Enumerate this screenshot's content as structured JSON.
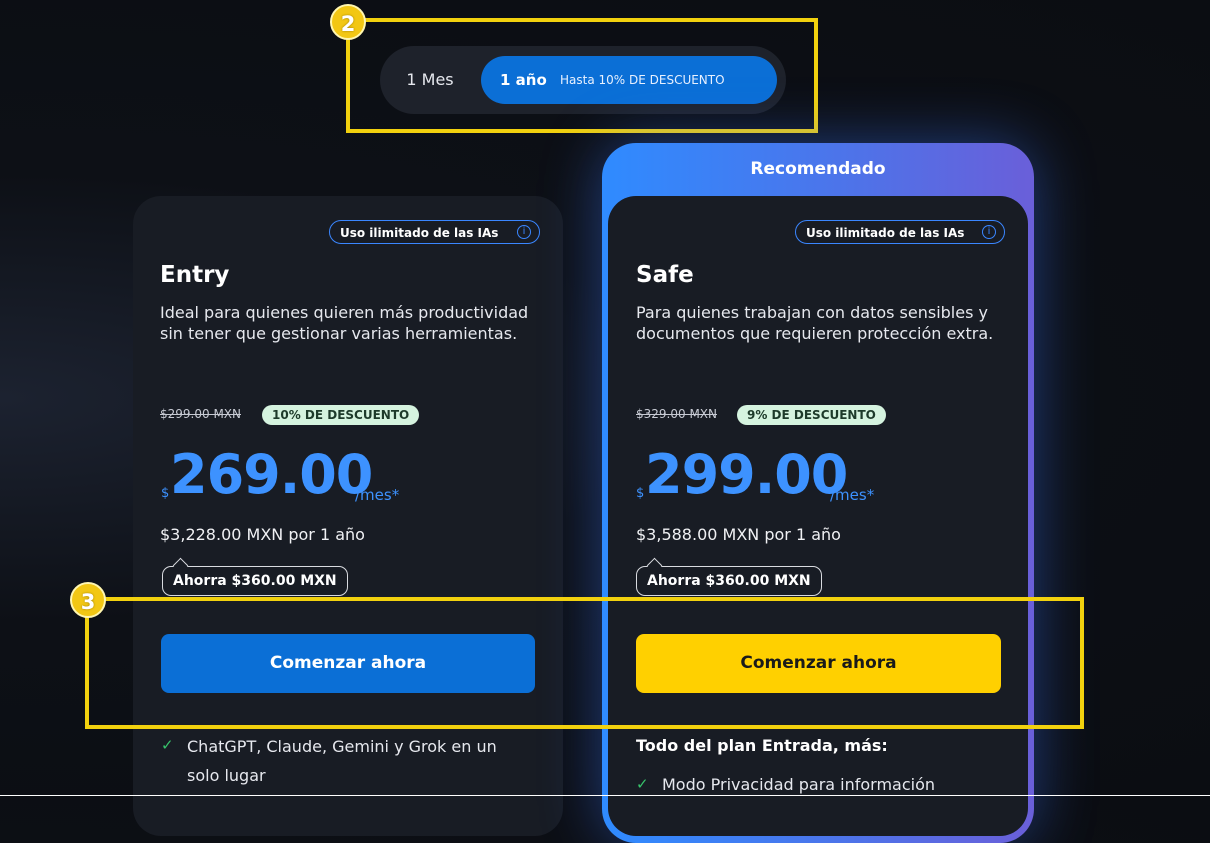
{
  "billing_toggle": {
    "month_label": "1 Mes",
    "year_label": "1 año",
    "year_discount": "Hasta 10% DE DESCUENTO"
  },
  "annotations": {
    "badge_2": "2",
    "badge_3": "3"
  },
  "recommended_label": "Recomendado",
  "plans": [
    {
      "ia_pill": "Uso ilimitado de las IAs",
      "title": "Entry",
      "description": "Ideal para quienes quieren más productividad sin tener que gestionar varias herramientas.",
      "old_price": "$299.00 MXN",
      "discount": "10% DE DESCUENTO",
      "currency": "$",
      "price": "269.00",
      "per": "/mes*",
      "total": "$3,228.00 MXN por 1 año",
      "savings": "Ahorra $360.00 MXN",
      "cta": "Comenzar ahora",
      "features": [
        "ChatGPT, Claude, Gemini y Grok en un",
        "solo lugar"
      ]
    },
    {
      "ia_pill": "Uso ilimitado de las IAs",
      "title": "Safe",
      "description": "Para quienes trabajan con datos sensibles y documentos que requieren protección extra.",
      "old_price": "$329.00 MXN",
      "discount": "9% DE DESCUENTO",
      "currency": "$",
      "price": "299.00",
      "per": "/mes*",
      "total": "$3,588.00 MXN por 1 año",
      "savings": "Ahorra $360.00 MXN",
      "cta": "Comenzar ahora",
      "section_head": "Todo del plan Entrada, más:",
      "features": [
        "Modo Privacidad para información"
      ]
    }
  ],
  "icons": {
    "check": "check-icon",
    "info": "info-icon"
  },
  "colors": {
    "accent_blue": "#0b6fd6",
    "price_blue": "#3d92ff",
    "cta_yellow": "#ffd000",
    "annotation": "#f2d10e"
  }
}
